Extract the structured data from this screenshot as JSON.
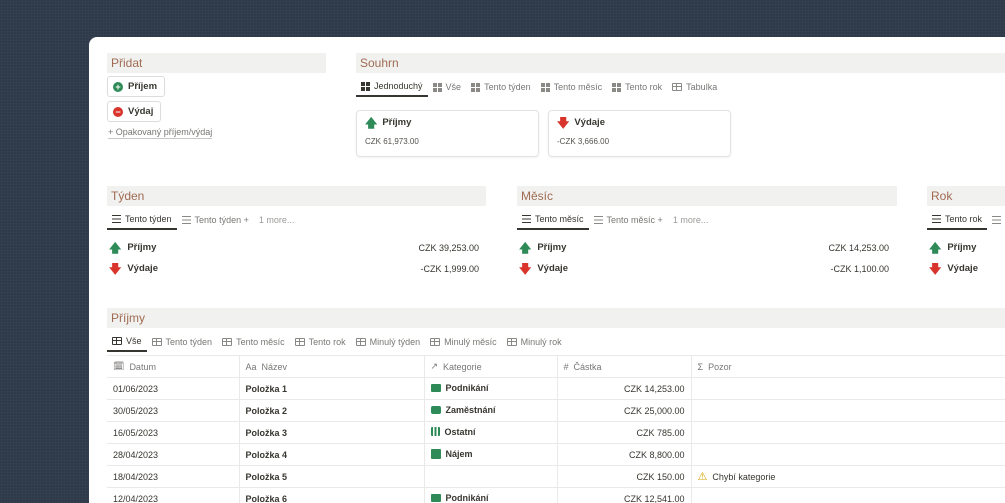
{
  "pridat": {
    "title": "Přidat",
    "prijem_btn": "Příjem",
    "vydaj_btn": "Výdaj",
    "recurring_link": "+ Opakovaný příjem/výdaj"
  },
  "souhrn": {
    "title": "Souhrn",
    "tabs": [
      "Jednoduchý",
      "Vše",
      "Tento týden",
      "Tento měsíc",
      "Tento rok",
      "Tabulka"
    ],
    "cards": [
      {
        "label": "Příjmy",
        "value": "CZK 61,973.00"
      },
      {
        "label": "Výdaje",
        "value": "-CZK 3,666.00"
      }
    ]
  },
  "tyden": {
    "title": "Týden",
    "tabs": [
      "Tento týden",
      "Tento týden +",
      "1 more..."
    ],
    "rows": [
      {
        "label": "Příjmy",
        "value": "CZK 39,253.00"
      },
      {
        "label": "Výdaje",
        "value": "-CZK 1,999.00"
      }
    ]
  },
  "mesic": {
    "title": "Měsíc",
    "tabs": [
      "Tento měsíc",
      "Tento měsíc +",
      "1 more..."
    ],
    "rows": [
      {
        "label": "Příjmy",
        "value": "CZK 14,253.00"
      },
      {
        "label": "Výdaje",
        "value": "-CZK 1,100.00"
      }
    ]
  },
  "rok": {
    "title": "Rok",
    "tabs": [
      "Tento rok"
    ],
    "rows": [
      {
        "label": "Příjmy"
      },
      {
        "label": "Výdaje"
      }
    ]
  },
  "prijmy": {
    "title": "Příjmy",
    "tabs": [
      "Vše",
      "Tento týden",
      "Tento měsíc",
      "Tento rok",
      "Minulý týden",
      "Minulý měsíc",
      "Minulý rok"
    ],
    "columns": [
      "Datum",
      "Název",
      "Kategorie",
      "Částka",
      "Pozor"
    ],
    "rows": [
      {
        "datum": "01/06/2023",
        "nazev": "Položka 1",
        "kategorie": "Podnikání",
        "castka": "CZK 14,253.00",
        "pozor": ""
      },
      {
        "datum": "30/05/2023",
        "nazev": "Položka 2",
        "kategorie": "Zaměstnání",
        "castka": "CZK 25,000.00",
        "pozor": ""
      },
      {
        "datum": "16/05/2023",
        "nazev": "Položka 3",
        "kategorie": "Ostatní",
        "castka": "CZK 785.00",
        "pozor": ""
      },
      {
        "datum": "28/04/2023",
        "nazev": "Položka 4",
        "kategorie": "Nájem",
        "castka": "CZK 8,800.00",
        "pozor": ""
      },
      {
        "datum": "18/04/2023",
        "nazev": "Položka 5",
        "kategorie": "",
        "castka": "CZK 150.00",
        "pozor": "Chybí kategorie"
      },
      {
        "datum": "12/04/2023",
        "nazev": "Položka 6",
        "kategorie": "Podnikání",
        "castka": "CZK 12,541.00",
        "pozor": ""
      }
    ]
  },
  "colors": {
    "accent_title": "#9f6b53",
    "income": "#2e8b57",
    "expense": "#d9342b",
    "background": "#2e3a4a"
  }
}
